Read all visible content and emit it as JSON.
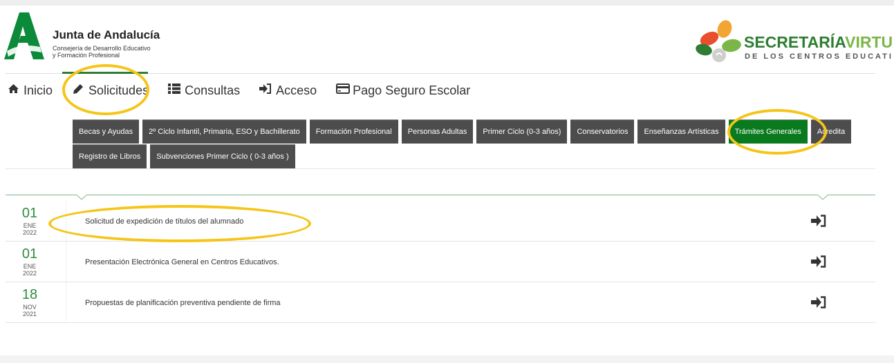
{
  "header": {
    "org_title": "Junta de Andalucía",
    "org_subtitle_1": "Consejería de Desarrollo Educativo",
    "org_subtitle_2": "y Formación Profesional",
    "sv_title_part1": "SECRETARÍA",
    "sv_title_part2": "VIRTU",
    "sv_subtitle": "DE LOS CENTROS EDUCATI"
  },
  "nav": {
    "items": [
      {
        "label": "Inicio",
        "icon": "home-icon"
      },
      {
        "label": "Solicitudes",
        "icon": "pencil-icon"
      },
      {
        "label": "Consultas",
        "icon": "list-icon"
      },
      {
        "label": "Acceso",
        "icon": "sign-in-icon"
      },
      {
        "label": "Pago Seguro Escolar",
        "icon": "credit-card-icon"
      }
    ],
    "active": "Solicitudes"
  },
  "categories": {
    "row1": [
      "Becas y Ayudas",
      "2º Ciclo Infantil, Primaria, ESO y Bachillerato",
      "Formación Profesional",
      "Personas Adultas",
      "Primer Ciclo (0-3 años)",
      "Conservatorios",
      "Enseñanzas Artísticas",
      "Trámites Generales",
      "Acredita"
    ],
    "row2": [
      "Registro de Libros",
      "Subvenciones Primer Ciclo ( 0-3 años )"
    ],
    "active": "Trámites Generales"
  },
  "list": {
    "items": [
      {
        "day": "01",
        "month": "ENE",
        "year": "2022",
        "title": "Solicitud de expedición de títulos del alumnado"
      },
      {
        "day": "01",
        "month": "ENE",
        "year": "2022",
        "title": "Presentación Electrónica General en Centros Educativos."
      },
      {
        "day": "18",
        "month": "NOV",
        "year": "2021",
        "title": "Propuestas de planificación preventiva pendiente de firma"
      }
    ]
  },
  "colors": {
    "brand_green": "#2e7d32",
    "active_tab": "#0a7a1f",
    "tab_bg": "#4d4d4d",
    "highlight": "#f5c518"
  }
}
